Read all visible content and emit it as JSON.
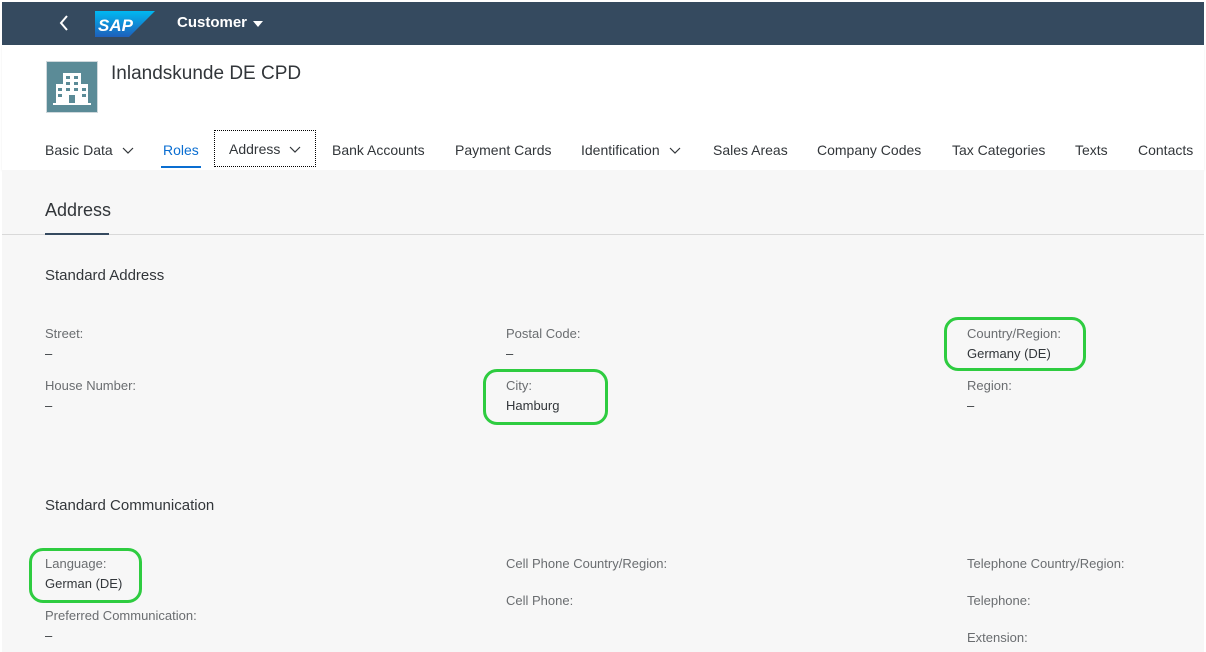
{
  "shell": {
    "app_title": "Customer",
    "logo_text": "SAP"
  },
  "header": {
    "title": "Inlandskunde DE CPD"
  },
  "tabs": [
    {
      "label": "Basic Data",
      "has_menu": true
    },
    {
      "label": "Roles",
      "has_menu": false,
      "active": true
    },
    {
      "label": "Address",
      "has_menu": true,
      "focused": true
    },
    {
      "label": "Bank Accounts",
      "has_menu": false
    },
    {
      "label": "Payment Cards",
      "has_menu": false
    },
    {
      "label": "Identification",
      "has_menu": true
    },
    {
      "label": "Sales Areas",
      "has_menu": false
    },
    {
      "label": "Company Codes",
      "has_menu": false
    },
    {
      "label": "Tax Categories",
      "has_menu": false
    },
    {
      "label": "Texts",
      "has_menu": false
    },
    {
      "label": "Contacts",
      "has_menu": false
    }
  ],
  "section": {
    "title": "Address"
  },
  "standard_address": {
    "title": "Standard Address",
    "street": {
      "label": "Street:",
      "value": "–"
    },
    "house_number": {
      "label": "House Number:",
      "value": "–"
    },
    "postal_code": {
      "label": "Postal Code:",
      "value": "–"
    },
    "city": {
      "label": "City:",
      "value": "Hamburg"
    },
    "country": {
      "label": "Country/Region:",
      "value": "Germany (DE)"
    },
    "region": {
      "label": "Region:",
      "value": "–"
    }
  },
  "standard_communication": {
    "title": "Standard Communication",
    "language": {
      "label": "Language:",
      "value": "German (DE)"
    },
    "preferred_communication": {
      "label": "Preferred Communication:",
      "value": "–"
    },
    "cell_phone_country": {
      "label": "Cell Phone Country/Region:"
    },
    "cell_phone": {
      "label": "Cell Phone:"
    },
    "telephone_country": {
      "label": "Telephone Country/Region:"
    },
    "telephone": {
      "label": "Telephone:"
    },
    "extension": {
      "label": "Extension:"
    }
  },
  "colors": {
    "shell_bg": "#354a5f",
    "accent": "#0a6ed1",
    "highlight": "#2ecc40"
  }
}
